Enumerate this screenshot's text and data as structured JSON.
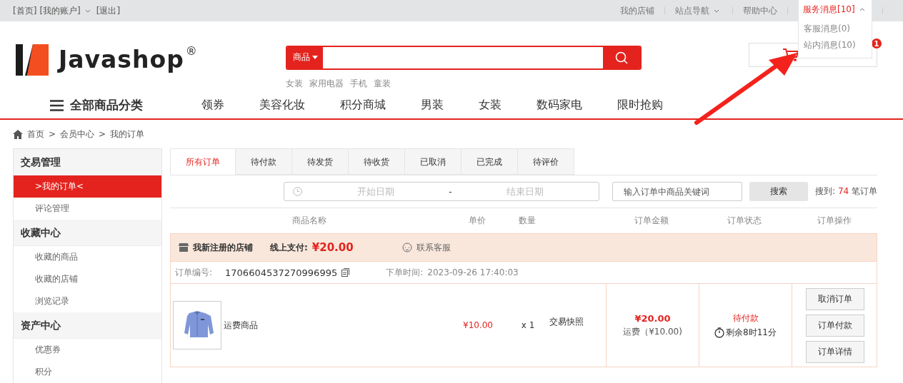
{
  "top_bar": {
    "left_links": [
      {
        "label": "[首页]",
        "dropdown": false
      },
      {
        "label": "[我的账户]",
        "dropdown": true
      },
      {
        "label": "[退出]",
        "dropdown": false
      }
    ],
    "right_links": [
      {
        "label": "我的店铺",
        "dropdown": false
      },
      {
        "label": "站点导航",
        "dropdown": true
      },
      {
        "label": "帮助中心",
        "dropdown": false
      }
    ],
    "messages": {
      "label": "服务消息[10]",
      "expanded": true,
      "items": [
        "客服消息(0)",
        "站内消息(10)"
      ]
    }
  },
  "header": {
    "logo": {
      "text": "Javashop",
      "mark": "®"
    },
    "search": {
      "scope": "商品"
    },
    "hot_words": [
      "女装",
      "家用电器",
      "手机",
      "童装"
    ],
    "cart": {
      "badge": "1"
    }
  },
  "nav": {
    "all_categories": "全部商品分类",
    "items": [
      "领券",
      "美容化妆",
      "积分商城",
      "男装",
      "女装",
      "数码家电",
      "限时抢购"
    ]
  },
  "breadcrumb": {
    "separator": ">",
    "items": [
      "首页",
      "会员中心",
      "我的订单"
    ]
  },
  "sidebar": [
    {
      "title": "交易管理",
      "items": [
        {
          "label": ">我的订单<",
          "selected": true
        },
        {
          "label": "评论管理",
          "selected": false
        }
      ]
    },
    {
      "title": "收藏中心",
      "items": [
        {
          "label": "收藏的商品",
          "selected": false
        },
        {
          "label": "收藏的店铺",
          "selected": false
        },
        {
          "label": "浏览记录",
          "selected": false
        }
      ]
    },
    {
      "title": "资产中心",
      "items": [
        {
          "label": "优惠券",
          "selected": false
        },
        {
          "label": "积分",
          "selected": false
        }
      ]
    }
  ],
  "tabs": [
    {
      "label": "所有订单",
      "selected": true
    },
    {
      "label": "待付款",
      "selected": false
    },
    {
      "label": "待发货",
      "selected": false
    },
    {
      "label": "待收货",
      "selected": false
    },
    {
      "label": "已取消",
      "selected": false
    },
    {
      "label": "已完成",
      "selected": false
    },
    {
      "label": "待评价",
      "selected": false
    }
  ],
  "filters": {
    "start_placeholder": "开始日期",
    "separator": "-",
    "end_placeholder": "结束日期",
    "keyword_placeholder": "输入订单中商品关键词",
    "search_button": "搜索",
    "result": {
      "prefix": "搜到:",
      "count": "74",
      "suffix": "笔订单"
    }
  },
  "columns": [
    "商品名称",
    "单价",
    "数量",
    "订单金额",
    "订单状态",
    "订单操作"
  ],
  "orders": [
    {
      "shop": "我新注册的店铺",
      "payment_label": "线上支付:",
      "amount": "¥20.00",
      "contact": "联系客服",
      "order_no_label": "订单编号:",
      "order_no": "1706604537270996995",
      "time_label": "下单时间:",
      "time": "2023-09-26 17:40:03",
      "items": [
        {
          "name": "运费商品",
          "price": "¥10.00",
          "quantity": "x 1",
          "snapshot": "交易快照"
        }
      ],
      "total": "¥20.00",
      "shipping": "运费（¥10.00)",
      "status": "待付款",
      "remaining": "剩余8时11分",
      "actions": [
        "取消订单",
        "订单付款",
        "订单详情"
      ]
    }
  ]
}
